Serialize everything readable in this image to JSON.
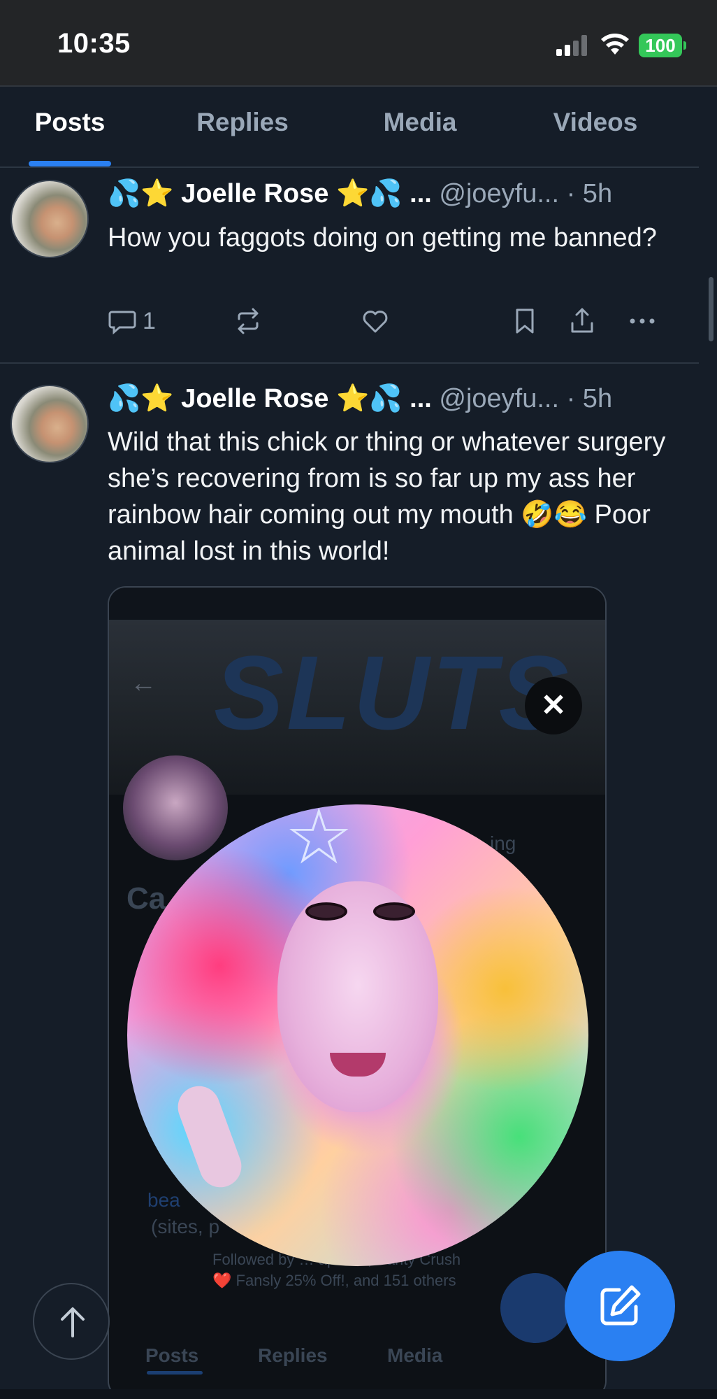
{
  "status_bar": {
    "time": "10:35",
    "battery": "100"
  },
  "tabs": [
    {
      "label": "Posts",
      "active": true
    },
    {
      "label": "Replies",
      "active": false
    },
    {
      "label": "Media",
      "active": false
    },
    {
      "label": "Videos",
      "active": false
    }
  ],
  "posts": [
    {
      "author": "💦⭐ Joelle Rose ⭐💦 ...",
      "handle": "@joeyfu...",
      "time": "· 5h",
      "text": "How you faggots doing on getting me banned?",
      "reply_count": "1"
    },
    {
      "author": "💦⭐ Joelle Rose ⭐💦 ...",
      "handle": "@joeyfu...",
      "time": "· 5h",
      "text": "Wild that this chick or thing or whatever surgery she’s recovering from is so far up my ass her rainbow hair coming out my mouth 🤣😂 Poor animal lost in this world!"
    }
  ],
  "embedded_screenshot": {
    "banner_text": "SLUTS",
    "close": "✕",
    "back": "←",
    "ghost_following": "ing",
    "ghost_name": "Ca",
    "ghost_link": "bea",
    "ghost_sites": "(sites, p",
    "ghost_followed_by": "Followed by … apa 🐶, Panty Crush",
    "ghost_fansly": "❤️ Fansly 25% Off!, and 151 others",
    "tabs": [
      "Posts",
      "Replies",
      "Media"
    ]
  },
  "colors": {
    "background": "#151d28",
    "accent": "#2a80f2",
    "muted_text": "#9aa8b8",
    "battery": "#34c759"
  },
  "icons": [
    "reply-icon",
    "repost-icon",
    "like-icon",
    "bookmark-icon",
    "share-icon",
    "more-icon",
    "arrow-up-icon",
    "compose-icon",
    "wifi-icon",
    "signal-icon"
  ]
}
